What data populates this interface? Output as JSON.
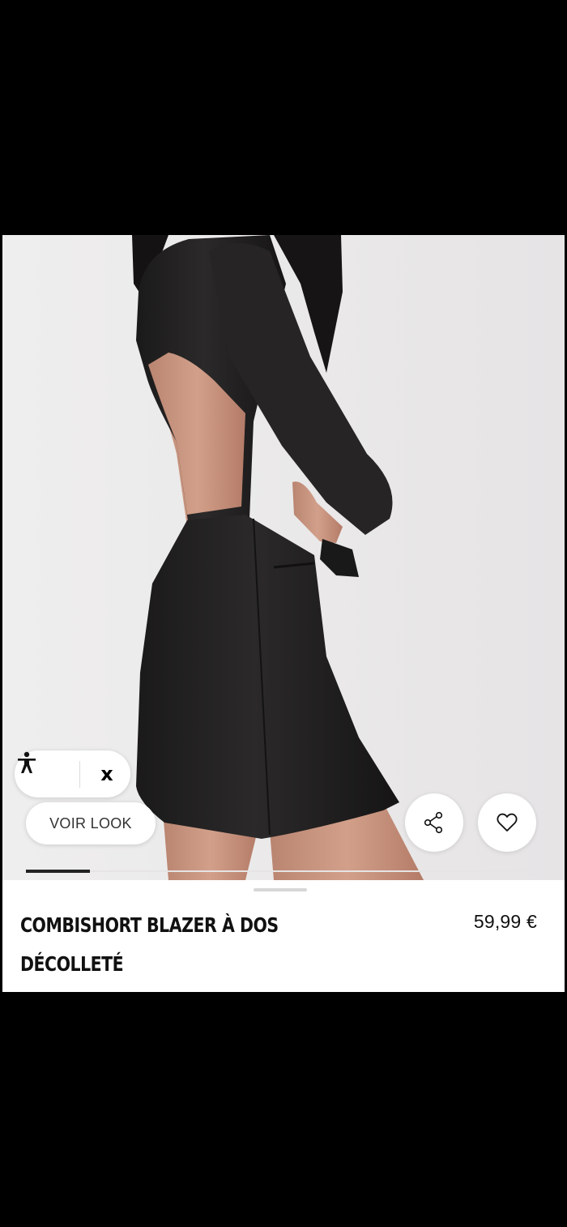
{
  "product": {
    "title": "COMBISHORT BLAZER À DOS DÉCOLLETÉ",
    "price": "59,99 €",
    "image_alt": "product-photo"
  },
  "controls": {
    "accessibility_icon": "accessibility-person-icon",
    "close_label": "x",
    "look_button_label": "VOIR LOOK",
    "share_icon": "share-icon",
    "favorite_icon": "heart-icon"
  },
  "gallery": {
    "progress": 0.125
  },
  "colors": {
    "background": "#000000",
    "photo_bg": "#ebe9ea",
    "garment": "#232121",
    "skin": "#c99680",
    "text": "#111111"
  }
}
